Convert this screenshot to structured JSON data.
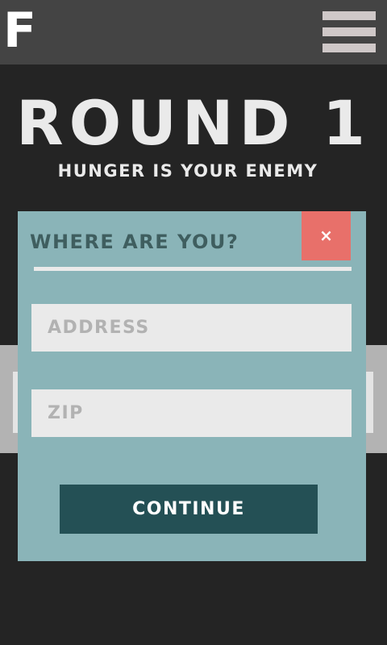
{
  "header": {
    "logo_text": "F",
    "menu_icon": "hamburger-menu-icon"
  },
  "hero": {
    "title": "ROUND 1",
    "subtitle": "HUNGER IS YOUR ENEMY"
  },
  "modal": {
    "title": "WHERE ARE YOU?",
    "close_symbol": "×",
    "close_icon": "close-icon",
    "address_placeholder": "ADDRESS",
    "address_value": "",
    "zip_placeholder": "ZIP",
    "zip_value": "",
    "continue_label": "CONTINUE"
  },
  "colors": {
    "background": "#242424",
    "header_bar": "#444444",
    "modal_bg": "#8ab4b8",
    "modal_title": "#3f5e5f",
    "close_button": "#e8706a",
    "continue_button": "#245055",
    "field_bg": "#eaeaea",
    "placeholder_text": "#b2b2b2"
  }
}
